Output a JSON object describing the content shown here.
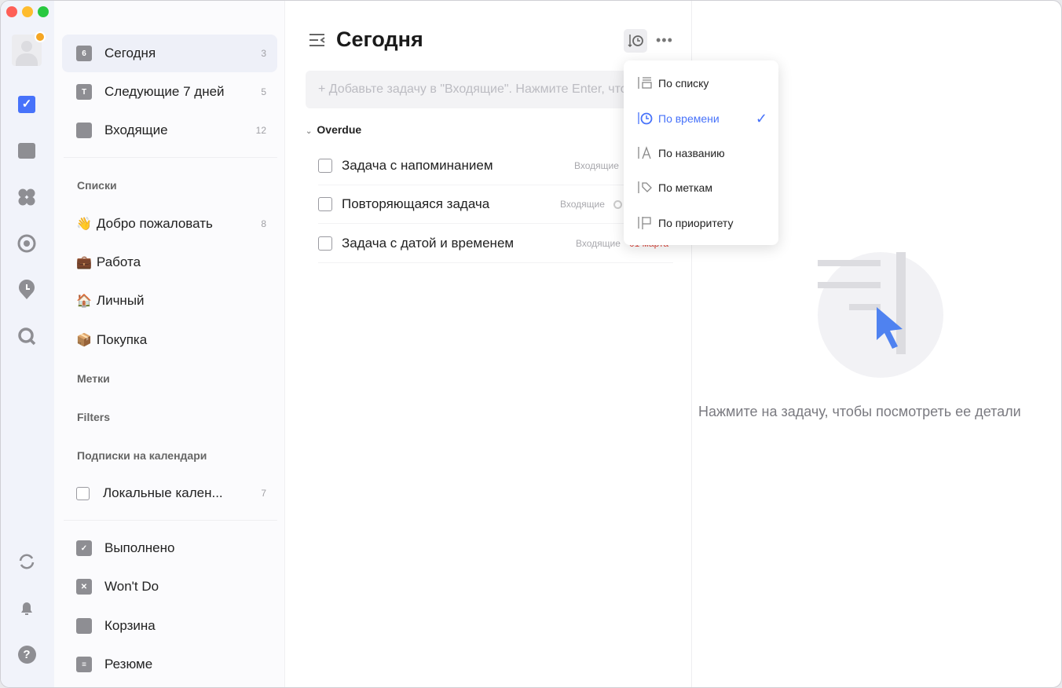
{
  "rail": {
    "icons": [
      "avatar",
      "crown-badge",
      "tasks-icon",
      "calendar-icon",
      "matrix-icon",
      "habit-icon",
      "pomodoro-icon",
      "search-icon",
      "sync-icon",
      "bell-icon",
      "help-icon"
    ]
  },
  "sidebar": {
    "smart": [
      {
        "label": "Сегодня",
        "count": "3",
        "icon_text": "6"
      },
      {
        "label": "Следующие 7 дней",
        "count": "5",
        "icon_text": "T"
      },
      {
        "label": "Входящие",
        "count": "12"
      }
    ],
    "lists_header": "Списки",
    "lists": [
      {
        "emoji": "👋",
        "label": "Добро пожаловать",
        "count": "8"
      },
      {
        "emoji": "💼",
        "label": "Работа"
      },
      {
        "emoji": "🏠",
        "label": "Личный"
      },
      {
        "emoji": "📦",
        "label": "Покупка"
      }
    ],
    "tags_header": "Метки",
    "filters_header": "Filters",
    "subs_header": "Подписки на календари",
    "subs": [
      {
        "label": "Локальные кален...",
        "count": "7"
      }
    ],
    "bottom": [
      {
        "label": "Выполнено"
      },
      {
        "label": "Won't Do"
      },
      {
        "label": "Корзина"
      },
      {
        "label": "Резюме"
      }
    ]
  },
  "main": {
    "title": "Сегодня",
    "add_placeholder": "+ Добавьте задачу в \"Входящие\". Нажмите Enter, чтобы сохранить.",
    "section": "Overdue",
    "tasks": [
      {
        "title": "Задача с напоминанием",
        "list": "Входящие"
      },
      {
        "title": "Повторяющаяся задача",
        "list": "Входящие"
      },
      {
        "title": "Задача с датой и временем",
        "list": "Входящие",
        "date": "01 марта"
      }
    ]
  },
  "sort_menu": {
    "items": [
      {
        "label": "По списку"
      },
      {
        "label": "По времени",
        "selected": true
      },
      {
        "label": "По названию"
      },
      {
        "label": "По меткам"
      },
      {
        "label": "По приоритету"
      }
    ]
  },
  "detail": {
    "hint": "Нажмите на задачу, чтобы посмотреть ее детали"
  },
  "colors": {
    "accent": "#4772fa",
    "overdue": "#e0453a"
  }
}
